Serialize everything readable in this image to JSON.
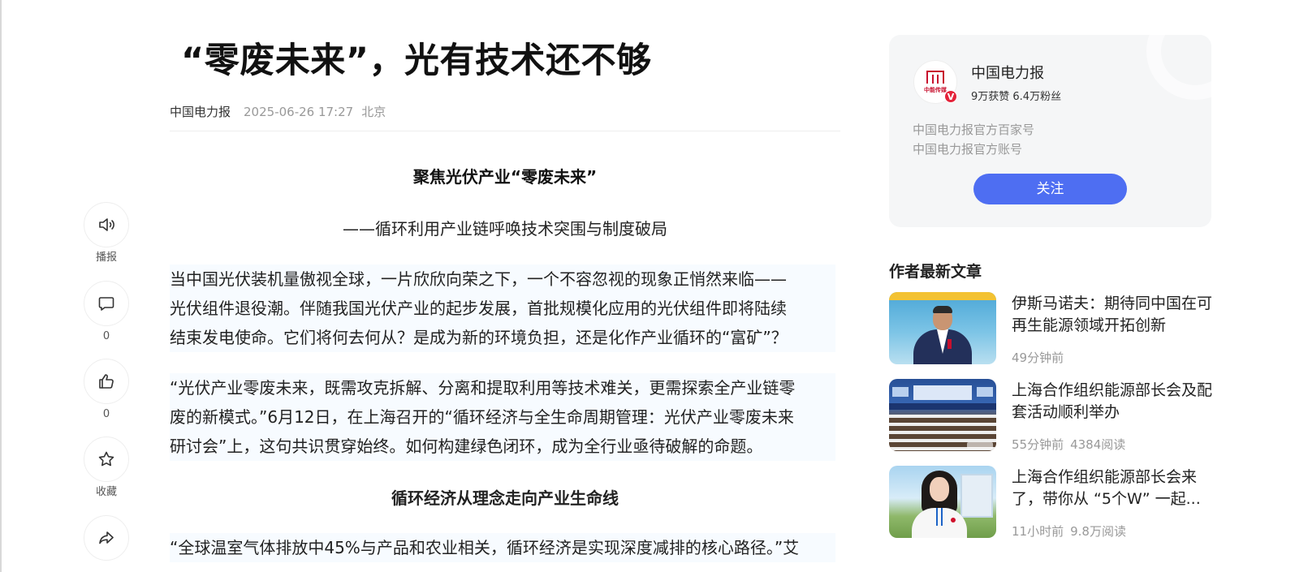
{
  "article": {
    "title": "“零废未来”，光有技术还不够",
    "meta": {
      "author": "中国电力报",
      "date": "2025-06-26 17:27",
      "location": "北京"
    },
    "subtitle_main": "聚焦光伏产业“零废未来”",
    "subtitle_sub": "——循环利用产业链呼唤技术突围与制度破局",
    "paragraph1": [
      "当中国光伏装机量傲视全球，一片欣欣向荣之下，一个不容忽视的现象正悄然来临——",
      "光伏组件退役潮。伴随我国光伏产业的起步发展，首批规模化应用的光伏组件即将陆续",
      "结束发电使命。它们将何去何从？是成为新的环境负担，还是化作产业循环的“富矿”？"
    ],
    "paragraph2": [
      "“光伏产业零废未来，既需攻克拆解、分离和提取利用等技术难关，更需探索全产业链零",
      "废的新模式。”6月12日，在上海召开的“循环经济与全生命周期管理：光伏产业零废未来",
      "研讨会”上，这句共识贯穿始终。如何构建绿色闭环，成为全行业亟待破解的命题。"
    ],
    "section_heading": "循环经济从理念走向产业生命线",
    "paragraph3": [
      "“全球温室气体排放中45%与产品和农业相关，循环经济是实现深度减排的核心路径。”艾"
    ]
  },
  "rail": {
    "play": {
      "icon": "speaker-icon",
      "label": "播报"
    },
    "comment": {
      "icon": "comment-icon",
      "count": "0"
    },
    "like": {
      "icon": "thumbs-up-icon",
      "count": "0"
    },
    "collect": {
      "icon": "star-icon",
      "label": "收藏"
    },
    "share": {
      "icon": "share-icon"
    }
  },
  "author_card": {
    "avatar_text": "中能传媒",
    "verified_badge": "V",
    "name": "中国电力报",
    "stats": "9万获赞 6.4万粉丝",
    "desc1": "中国电力报官方百家号",
    "desc2": "中国电力报官方账号",
    "follow_label": "关注",
    "accent_color": "#4e6ef2"
  },
  "latest": {
    "heading": "作者最新文章",
    "items": [
      {
        "title_lines": [
          "伊斯马诺夫：期待同中国在可",
          "再生能源领域开拓创新"
        ],
        "time": "49分钟前",
        "reads": ""
      },
      {
        "title_lines": [
          "上海合作组织能源部长会及配",
          "套活动顺利举办"
        ],
        "time": "55分钟前",
        "reads": "4384阅读"
      },
      {
        "title_lines": [
          "上海合作组织能源部长会来",
          "了，带你从 “5个W” 一起..."
        ],
        "time": "11小时前",
        "reads": "9.8万阅读"
      }
    ]
  }
}
